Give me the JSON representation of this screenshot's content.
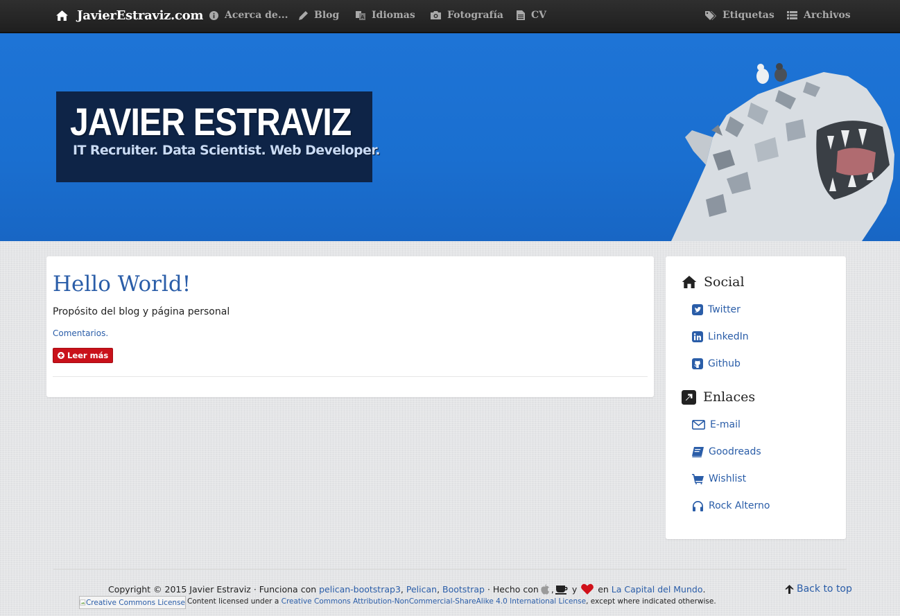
{
  "navbar": {
    "brand": "JavierEstraviz.com",
    "items": [
      {
        "label": "Acerca de...",
        "icon": "info-icon"
      },
      {
        "label": "Blog",
        "icon": "pencil-icon"
      },
      {
        "label": "Idiomas",
        "icon": "language-icon"
      },
      {
        "label": "Fotografía",
        "icon": "camera-icon"
      },
      {
        "label": "CV",
        "icon": "file-icon"
      }
    ],
    "right_items": [
      {
        "label": "Etiquetas",
        "icon": "tags-icon"
      },
      {
        "label": "Archivos",
        "icon": "list-icon"
      }
    ]
  },
  "hero": {
    "name": "JAVIER ESTRAVIZ",
    "tagline": "IT Recruiter. Data Scientist. Web Developer.",
    "colors": {
      "background": "#1e74d6",
      "box": "#0e2447"
    }
  },
  "post": {
    "title": "Hello World!",
    "summary": "Propósito del blog y página personal",
    "comments_link": "Comentarios.",
    "read_more": "Leer más"
  },
  "sidebar": {
    "social_title": "Social",
    "social": [
      {
        "label": "Twitter",
        "icon": "twitter-icon"
      },
      {
        "label": "LinkedIn",
        "icon": "linkedin-icon"
      },
      {
        "label": "Github",
        "icon": "github-icon"
      }
    ],
    "links_title": "Enlaces",
    "links": [
      {
        "label": "E-mail",
        "icon": "envelope-icon"
      },
      {
        "label": "Goodreads",
        "icon": "book-icon"
      },
      {
        "label": "Wishlist",
        "icon": "cart-icon"
      },
      {
        "label": "Rock Alterno",
        "icon": "headphones-icon"
      }
    ]
  },
  "footer": {
    "copyright": "Copyright © 2015 Javier Estraviz · Funciona con",
    "link_pelican_bootstrap": "pelican-bootstrap3",
    "sep1": ",",
    "link_pelican": "Pelican",
    "sep2": ",",
    "link_bootstrap": "Bootstrap",
    "made_with": "· Hecho con",
    "comma": ",",
    "and": "y",
    "in": "en",
    "link_place": "La Capital del Mundo",
    "period": ".",
    "license_img_alt": "Creative Commons License",
    "license_prefix": "Content licensed under a",
    "license_link": "Creative Commons Attribution-NonCommercial-ShareAlike 4.0 International License",
    "license_suffix": ", except where indicated otherwise.",
    "back_to_top": "Back to top"
  },
  "colors": {
    "link": "#2a5da8",
    "button_red": "#c9111a",
    "heart": "#d0111a"
  }
}
